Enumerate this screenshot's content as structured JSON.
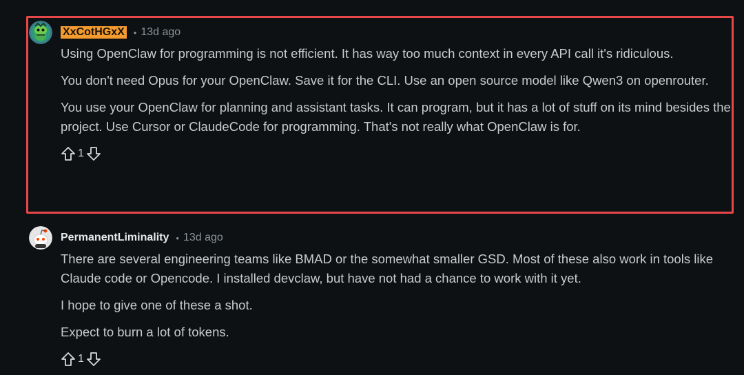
{
  "comments": [
    {
      "author": "XxCotHGxX",
      "dot": "•",
      "time": "13d ago",
      "paragraphs": [
        "Using OpenClaw for programming is not efficient. It has way too much context in every API call it's ridiculous.",
        "You don't need Opus for your OpenClaw. Save it for the CLI. Use an open source model like Qwen3 on openrouter.",
        "You use your OpenClaw for planning and assistant tasks. It can program, but it has a lot of stuff on its mind besides the project. Use Cursor or ClaudeCode for programming. That's not really what OpenClaw is for."
      ],
      "score": "1",
      "avatar_icon": "snoo-avatar-icon",
      "highlight_color": "#e8474a",
      "author_highlight_color": "#f39b2f"
    },
    {
      "author": "PermanentLiminality",
      "dot": "•",
      "time": "13d ago",
      "paragraphs": [
        "There are several engineering teams like BMAD or the somewhat smaller GSD. Most of these also work in tools like Claude code or Opencode. I installed devclaw, but have not had a chance to work with it yet.",
        "I hope to give one of these a shot.",
        "Expect to burn a lot of tokens."
      ],
      "score": "1",
      "avatar_icon": "snoo-avatar-icon"
    }
  ],
  "icons": {
    "upvote": "arrow-up-icon",
    "downvote": "arrow-down-icon"
  }
}
